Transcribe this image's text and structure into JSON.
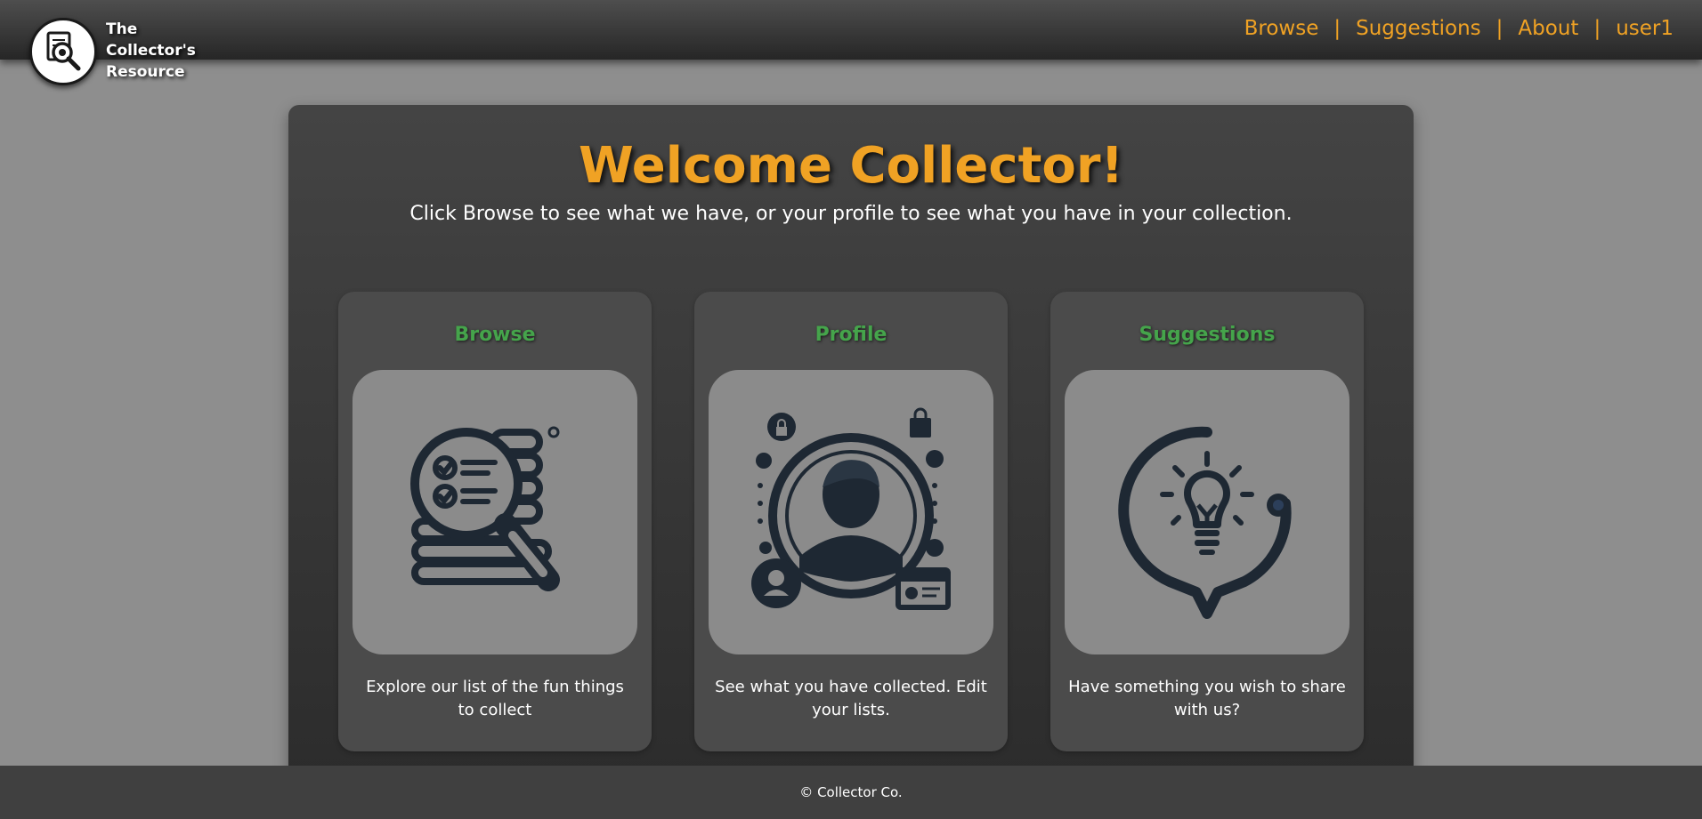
{
  "header": {
    "logo_lines": [
      "The",
      "Collector's",
      "Resource"
    ],
    "nav": [
      "Browse",
      "Suggestions",
      "About",
      "user1"
    ],
    "separator": "|"
  },
  "main": {
    "title": "Welcome Collector!",
    "subtitle": "Click Browse to see what we have, or your profile to see what you have in your collection.",
    "cards": [
      {
        "title": "Browse",
        "description": "Explore our list of the fun things to collect",
        "icon": "magnifier-list-icon"
      },
      {
        "title": "Profile",
        "description": "See what you have collected. Edit your lists.",
        "icon": "user-profile-icon"
      },
      {
        "title": "Suggestions",
        "description": "Have something you wish to share with us?",
        "icon": "lightbulb-icon"
      }
    ]
  },
  "footer": {
    "text": "© Collector Co."
  },
  "colors": {
    "accent": "#f0a224",
    "card_title": "#45a44b",
    "icon": "#1e2833"
  }
}
